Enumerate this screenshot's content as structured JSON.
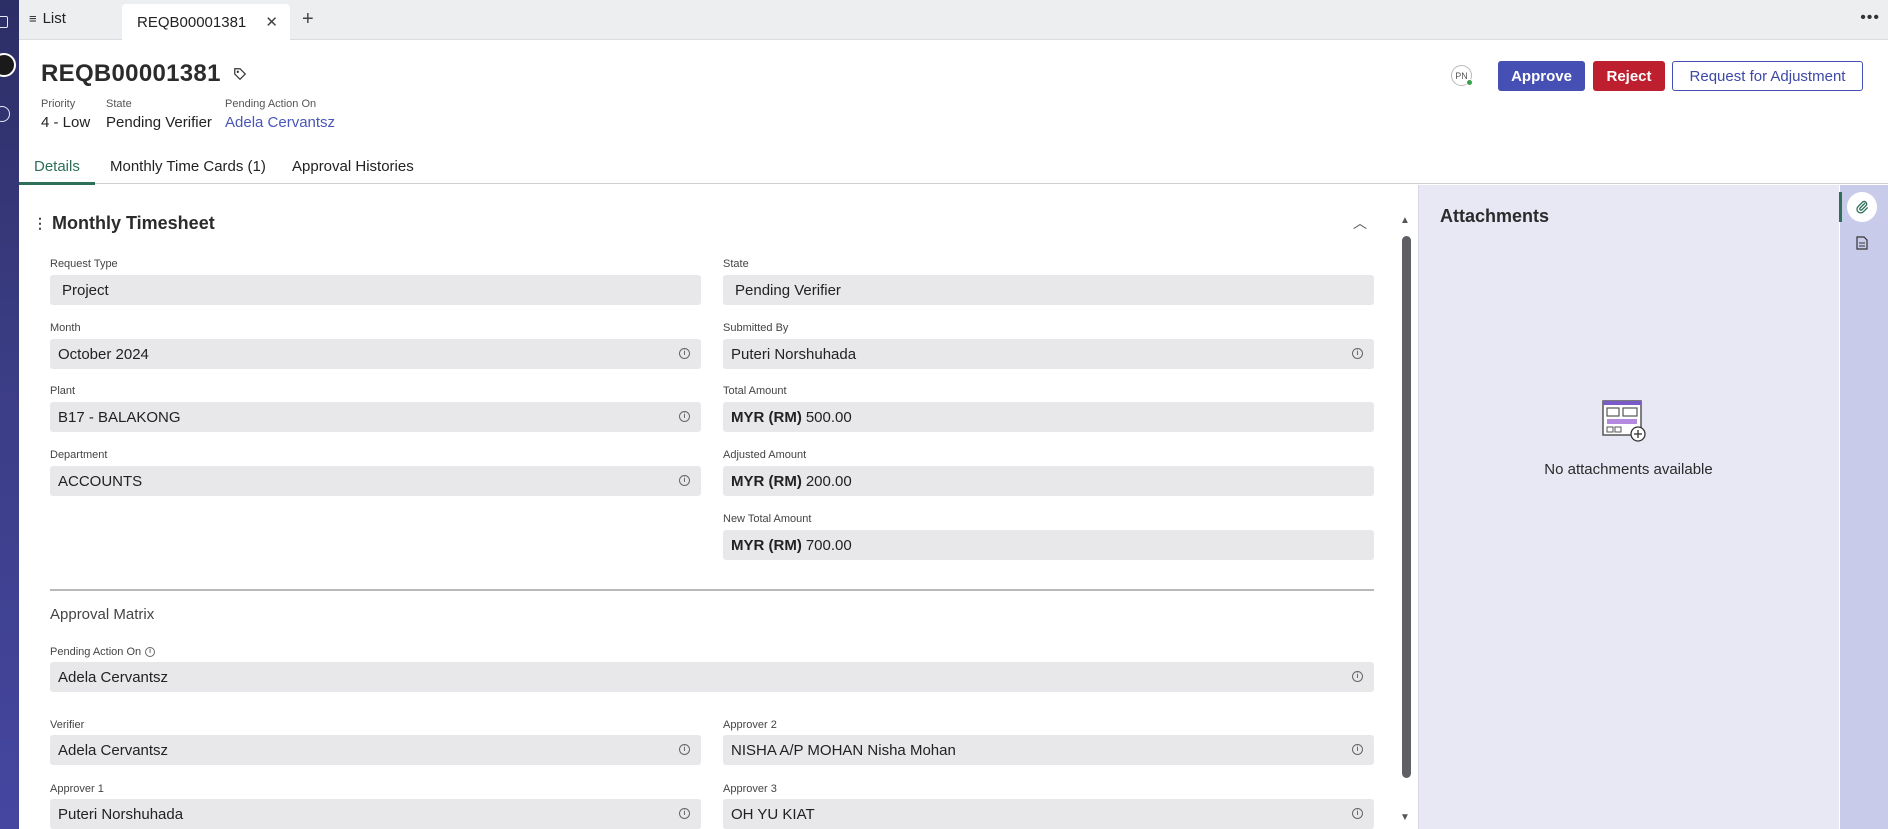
{
  "tabbar": {
    "list_label": "List",
    "active_tab": "REQB00001381"
  },
  "record": {
    "title": "REQB00001381",
    "priority_label": "Priority",
    "priority_value": "4 - Low",
    "state_label": "State",
    "state_value": "Pending Verifier",
    "pending_label": "Pending Action On",
    "pending_value": "Adela Cervantsz",
    "avatar_initials": "PN"
  },
  "actions": {
    "approve": "Approve",
    "reject": "Reject",
    "adjust": "Request for Adjustment"
  },
  "content_tabs": {
    "details": "Details",
    "timecards": "Monthly Time Cards (1)",
    "histories": "Approval Histories"
  },
  "section": {
    "title": "Monthly Timesheet",
    "request_type_label": "Request Type",
    "request_type_value": "Project",
    "state_label": "State",
    "state_value": "Pending Verifier",
    "month_label": "Month",
    "month_value": "October 2024",
    "submitted_by_label": "Submitted By",
    "submitted_by_value": "Puteri Norshuhada",
    "plant_label": "Plant",
    "plant_value": "B17 - BALAKONG",
    "total_amount_label": "Total Amount",
    "total_amount_currency": "MYR (RM)",
    "total_amount_value": "500.00",
    "department_label": "Department",
    "department_value": "ACCOUNTS",
    "adjusted_amount_label": "Adjusted Amount",
    "adjusted_amount_currency": "MYR (RM)",
    "adjusted_amount_value": "200.00",
    "new_total_label": "New Total Amount",
    "new_total_currency": "MYR (RM)",
    "new_total_value": "700.00"
  },
  "approval": {
    "title": "Approval Matrix",
    "pending_label": "Pending Action On",
    "pending_value": "Adela Cervantsz",
    "verifier_label": "Verifier",
    "verifier_value": "Adela Cervantsz",
    "approver2_label": "Approver 2",
    "approver2_value": "NISHA A/P MOHAN Nisha Mohan",
    "approver1_label": "Approver 1",
    "approver1_value": "Puteri Norshuhada",
    "approver3_label": "Approver 3",
    "approver3_value": "OH YU KIAT"
  },
  "attachments": {
    "title": "Attachments",
    "empty_text": "No attachments available"
  },
  "colors": {
    "primary": "#4650b4",
    "danger": "#bd1f2f",
    "accent_tab": "#2d6f5b",
    "link": "#4a57b8",
    "side_panel": "#e8e8f5"
  }
}
